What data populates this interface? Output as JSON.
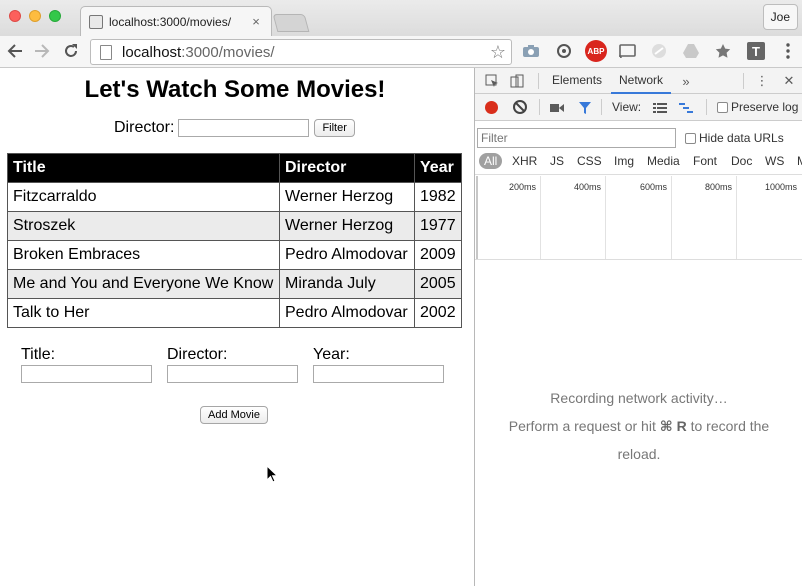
{
  "browser": {
    "tab_title": "localhost:3000/movies/",
    "tab_close": "×",
    "profile_name": "Joe",
    "url_host": "localhost",
    "url_path": ":3000/movies/",
    "star_icon": "☆",
    "ext_abp": "ABP",
    "ext_t": "T"
  },
  "page": {
    "title": "Let's Watch Some Movies!",
    "filter_label": "Director:",
    "filter_value": "",
    "filter_button": "Filter",
    "table": {
      "headers": [
        "Title",
        "Director",
        "Year"
      ],
      "rows": [
        [
          "Fitzcarraldo",
          "Werner Herzog",
          "1982"
        ],
        [
          "Stroszek",
          "Werner Herzog",
          "1977"
        ],
        [
          "Broken Embraces",
          "Pedro Almodovar",
          "2009"
        ],
        [
          "Me and You and Everyone We Know",
          "Miranda July",
          "2005"
        ],
        [
          "Talk to Her",
          "Pedro Almodovar",
          "2002"
        ]
      ]
    },
    "add_form": {
      "title_label": "Title:",
      "director_label": "Director:",
      "year_label": "Year:",
      "title_value": "",
      "director_value": "",
      "year_value": "",
      "submit_label": "Add Movie"
    }
  },
  "devtools": {
    "tabs": [
      "Elements",
      "Network"
    ],
    "active_tab": "Network",
    "more_tabs_icon": "»",
    "menu_icon": "⋮",
    "close_icon": "✕",
    "view_label": "View:",
    "preserve_log_label": "Preserve log",
    "filter_placeholder": "Filter",
    "hide_data_urls_label": "Hide data URLs",
    "types": [
      "All",
      "XHR",
      "JS",
      "CSS",
      "Img",
      "Media",
      "Font",
      "Doc",
      "WS",
      "M"
    ],
    "timeline_ticks": [
      "200ms",
      "400ms",
      "600ms",
      "800ms",
      "1000ms"
    ],
    "empty_line1": "Recording network activity…",
    "empty_line2_prefix": "Perform a request or hit ",
    "empty_shortcut": "⌘ R",
    "empty_line2_suffix": " to record the",
    "empty_line3": "reload.",
    "record_color": "#d92e1b",
    "active_tab_color": "#3879d9"
  }
}
